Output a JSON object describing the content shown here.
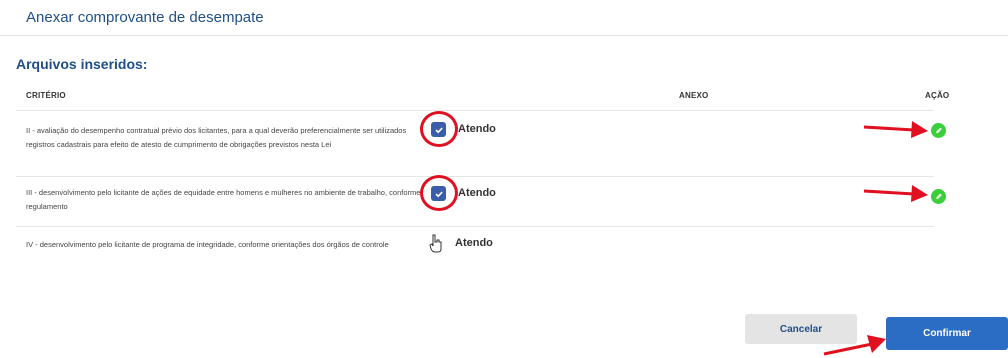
{
  "header": {
    "title": "Anexar comprovante de desempate"
  },
  "section": {
    "title": "Arquivos inseridos:"
  },
  "table": {
    "columns": [
      "CRITÉRIO",
      "ANEXO",
      "AÇÃO"
    ],
    "rows": [
      {
        "criterio": "II - avaliação do desempenho contratual prévio dos licitantes, para a qual deverão preferencialmente ser utilizados registros cadastrais para efeito de atesto de cumprimento de obrigações previstos nesta Lei",
        "status": "Atendo",
        "checked": true,
        "action_icon": "paperclip-icon"
      },
      {
        "criterio": "III - desenvolvimento pelo licitante de ações de equidade entre homens e mulheres no ambiente de trabalho, conforme regulamento",
        "status": "Atendo",
        "checked": true,
        "action_icon": "paperclip-icon"
      },
      {
        "criterio": "IV - desenvolvimento pelo licitante de programa de integridade, conforme orientações dos órgãos de controle",
        "status": "Atendo",
        "checked": false,
        "action_icon": ""
      }
    ]
  },
  "buttons": {
    "cancel": "Cancelar",
    "confirm": "Confirmar"
  },
  "colors": {
    "primary": "#2b6cc4",
    "title": "#1f4f8a",
    "checkbox": "#3b5ea9",
    "action": "#3ccf3c",
    "annotation": "#e01020"
  }
}
